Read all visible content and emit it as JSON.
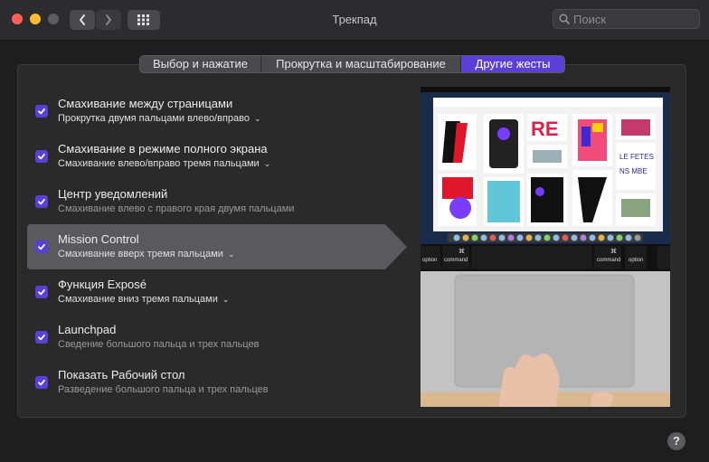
{
  "window": {
    "title": "Трекпад",
    "search_placeholder": "Поиск"
  },
  "tabs": [
    {
      "label": "Выбор и нажатие",
      "active": false
    },
    {
      "label": "Прокрутка и масштабирование",
      "active": false
    },
    {
      "label": "Другие жесты",
      "active": true
    }
  ],
  "gestures": [
    {
      "title": "Смахивание между страницами",
      "subtitle": "Прокрутка двумя пальцами влево/вправо",
      "has_dropdown": true,
      "checked": true
    },
    {
      "title": "Смахивание в режиме полного экрана",
      "subtitle": "Смахивание влево/вправо тремя пальцами",
      "has_dropdown": true,
      "checked": true
    },
    {
      "title": "Центр уведомлений",
      "subtitle": "Смахивание влево с правого края двумя пальцами",
      "has_dropdown": false,
      "checked": true
    },
    {
      "title": "Mission Control",
      "subtitle": "Смахивание вверх тремя пальцами",
      "has_dropdown": true,
      "checked": true,
      "selected": true
    },
    {
      "title": "Функция Exposé",
      "subtitle": "Смахивание вниз тремя пальцами",
      "has_dropdown": true,
      "checked": true
    },
    {
      "title": "Launchpad",
      "subtitle": "Сведение большого пальца и трех пальцев",
      "has_dropdown": false,
      "checked": true
    },
    {
      "title": "Показать Рабочий стол",
      "subtitle": "Разведение большого пальца и трех пальцев",
      "has_dropdown": false,
      "checked": true
    }
  ],
  "preview": {
    "keyboard": {
      "key_left": "option",
      "key_left_cmd": "command",
      "key_right_cmd": "command",
      "key_right": "option",
      "cmd_symbol": "⌘"
    }
  },
  "help_label": "?",
  "colors": {
    "accent": "#5b3fd8",
    "background": "#1e1e1e",
    "panel": "#2a2a2b"
  }
}
